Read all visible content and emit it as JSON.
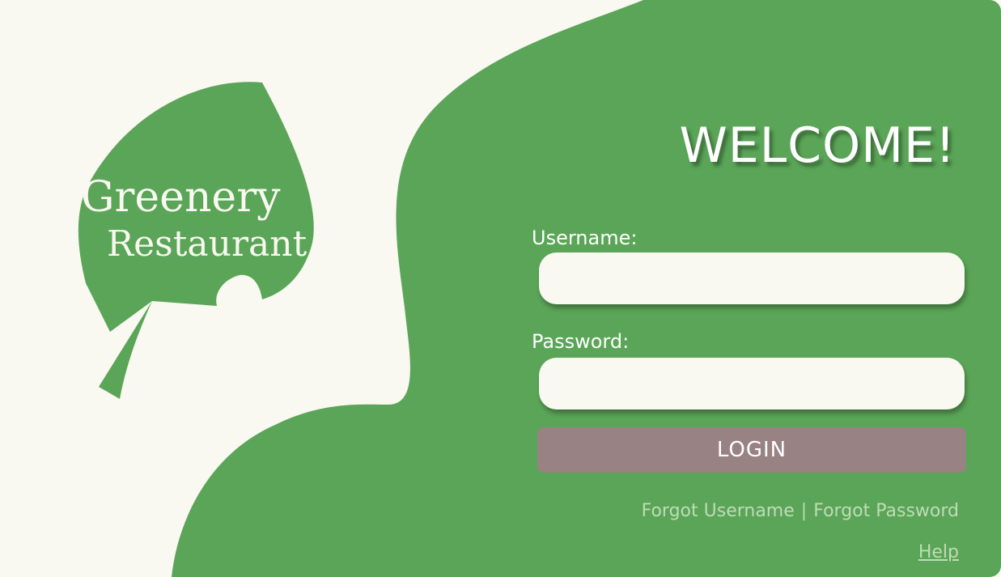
{
  "colors": {
    "green": "#5aa557",
    "cream": "#f9f8f1",
    "login_button": "#998284",
    "link": "#bfdcb6"
  },
  "logo": {
    "line1": "Greenery",
    "line2": "Restaurant",
    "icon": "leaf-icon"
  },
  "form": {
    "title": "WELCOME!",
    "username_label": "Username:",
    "username_value": "",
    "password_label": "Password:",
    "password_value": "",
    "login_label": "LOGIN",
    "forgot_username": "Forgot Username",
    "separator": "|",
    "forgot_password": "Forgot Password",
    "help": "Help"
  }
}
